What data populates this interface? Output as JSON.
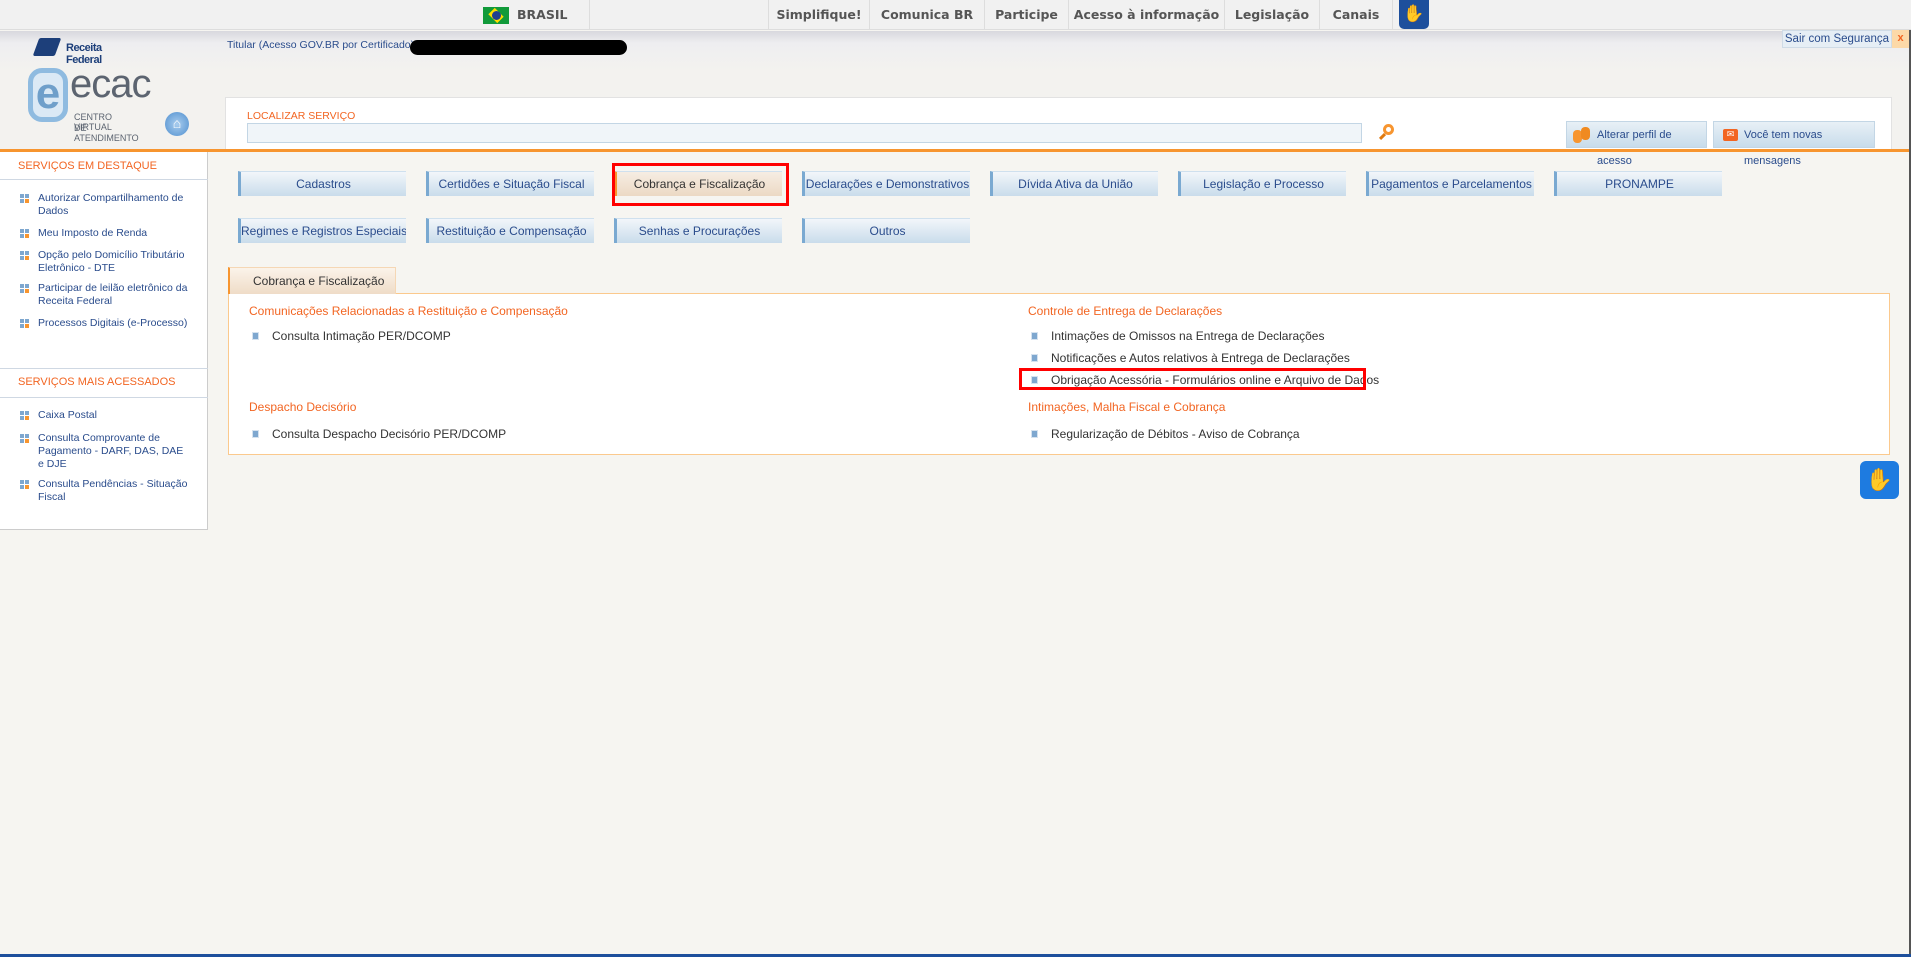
{
  "gov_bar": {
    "country": "BRASIL",
    "links": [
      "Simplifique!",
      "Comunica BR",
      "Participe",
      "Acesso à informação",
      "Legislação",
      "Canais"
    ],
    "accessibility_icon": "vlibras-hands-icon"
  },
  "header": {
    "org_logo": "Receita Federal",
    "app_logo": "ecac",
    "app_logo_sub1": "CENTRO VIRTUAL",
    "app_logo_sub2": "DE ATENDIMENTO",
    "titular_label": "Titular (Acesso GOV.BR por Certificado):",
    "logout_label": "Sair com Segurança",
    "logout_close": "x",
    "search_label": "LOCALIZAR SERVIÇO",
    "search_value": "",
    "change_profile_label": "Alterar perfil de acesso",
    "messages_label": "Você tem novas mensagens"
  },
  "sidebar": {
    "featured_title": "SERVIÇOS EM DESTAQUE",
    "featured": [
      "Autorizar Compartilhamento de Dados",
      "Meu Imposto de Renda",
      "Opção pelo Domicílio Tributário Eletrônico - DTE",
      "Participar de leilão eletrônico da Receita Federal",
      "Processos Digitais (e-Processo)"
    ],
    "most_title": "SERVIÇOS MAIS ACESSADOS",
    "most": [
      "Caixa Postal",
      "Consulta Comprovante de Pagamento - DARF, DAS, DAE e DJE",
      "Consulta Pendências - Situação Fiscal"
    ]
  },
  "categories": [
    "Cadastros",
    "Certidões e Situação Fiscal",
    "Cobrança e Fiscalização",
    "Declarações e Demonstrativos",
    "Dívida Ativa da União",
    "Legislação e Processo",
    "Pagamentos e Parcelamentos",
    "PRONAMPE",
    "Regimes e Registros Especiais",
    "Restituição e Compensação",
    "Senhas e Procurações",
    "Outros"
  ],
  "active_category": "Cobrança e Fiscalização",
  "panel": {
    "tab": "Cobrança e Fiscalização",
    "groups": [
      {
        "title": "Comunicações Relacionadas a Restituição e Compensação",
        "items": [
          "Consulta Intimação PER/DCOMP"
        ]
      },
      {
        "title": "Despacho Decisório",
        "items": [
          "Consulta Despacho Decisório PER/DCOMP"
        ]
      },
      {
        "title": "Controle de Entrega de Declarações",
        "items": [
          "Intimações de Omissos na Entrega de Declarações",
          "Notificações e Autos relativos à Entrega de Declarações",
          "Obrigação Acessória - Formulários online e Arquivo de Dados"
        ]
      },
      {
        "title": "Intimações, Malha Fiscal e Cobrança",
        "items": [
          "Regularização de Débitos - Aviso de Cobrança"
        ]
      }
    ]
  },
  "colors": {
    "accent": "#f7952f",
    "link": "#2a4c8c",
    "heading": "#f26522",
    "highlight": "#ff0000"
  }
}
